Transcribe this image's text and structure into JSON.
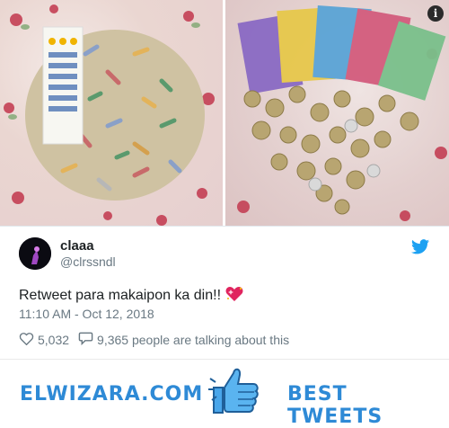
{
  "photos": {
    "left": "coin-rolls-and-bills-photo",
    "right": "bills-and-coins-photo",
    "info_icon": "i"
  },
  "tweet": {
    "display_name": "claaa",
    "handle": "@clrssndl",
    "text": "Retweet para makaipon ka din!!",
    "emoji": "sparkling-heart",
    "timestamp": "11:10 AM - Oct 12, 2018",
    "likes": "5,032",
    "conversation": "9,365 people are talking about this"
  },
  "banner": {
    "left_text": "ELWIZARA.COM",
    "right_text": "BEST TWEETS"
  },
  "colors": {
    "twitter_blue": "#1da1f2",
    "brand_blue": "#2e8ad6",
    "text_dark": "#1c2022",
    "text_gray": "#697882"
  }
}
